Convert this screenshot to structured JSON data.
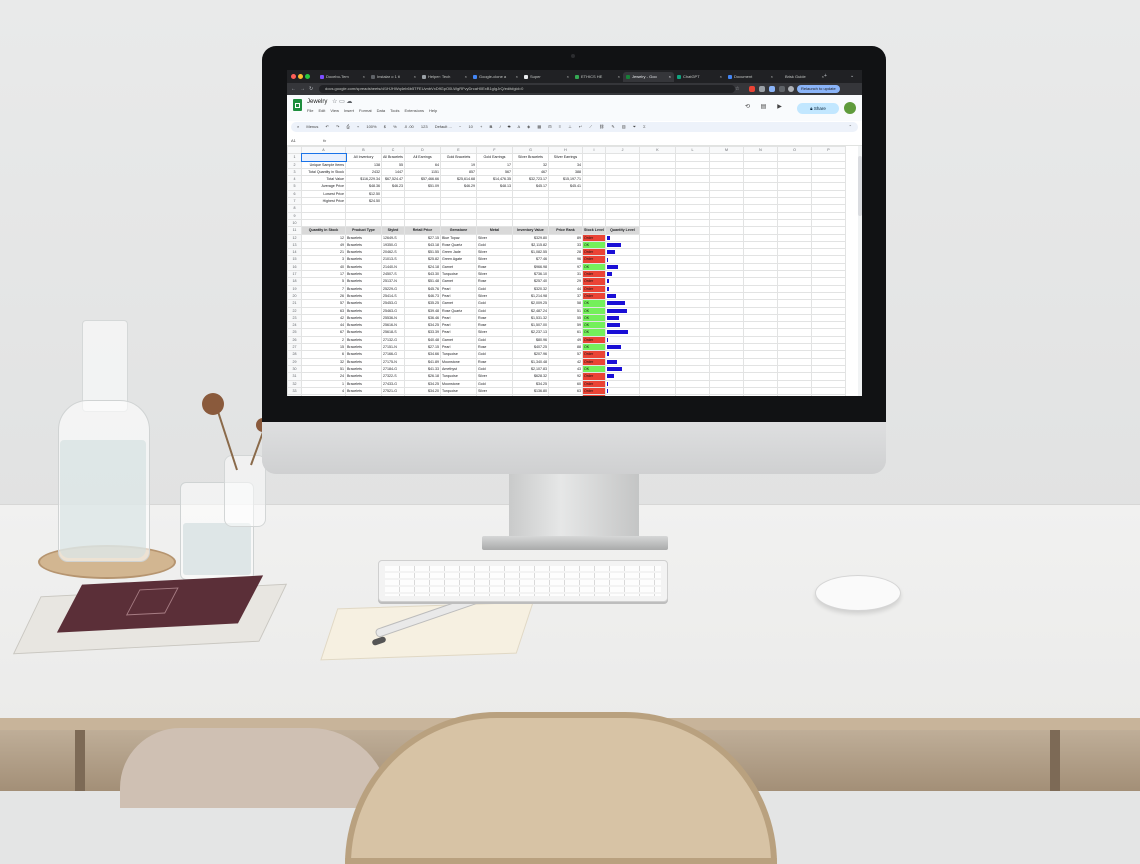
{
  "browser": {
    "tabs": [
      {
        "label": "Docebo-Tem",
        "icon_color": "#7c4dff"
      },
      {
        "label": "Instalar o 1 ti",
        "icon_color": "#5f6368"
      },
      {
        "label": "Helper: Tech",
        "icon_color": "#9aa0a6"
      },
      {
        "label": "Google-clone a",
        "icon_color": "#4285f4"
      },
      {
        "label": "Super",
        "icon_color": "#e8eaed"
      },
      {
        "label": "ETHICS HE",
        "icon_color": "#34a853"
      },
      {
        "label": "Jewelry - Goo",
        "icon_color": "#188038",
        "active": true
      },
      {
        "label": "ChatGPT",
        "icon_color": "#10a37f"
      },
      {
        "label": "Document",
        "icon_color": "#4285f4"
      },
      {
        "label": "Brisk Guide",
        "icon_color": "#202124"
      }
    ],
    "url": "docs.google.com/spreadsheets/d/1HJHWq4eb6b5TFEUvnbVxDflGpO0LWgRFvyDrcaH0ExB1gIgJrQ/edit#gid=0",
    "relaunch_label": "Relaunch to update",
    "new_tab_glyph": "+"
  },
  "sheets_app": {
    "doc_title": "Jewelry",
    "menus": [
      "File",
      "Edit",
      "View",
      "Insert",
      "Format",
      "Data",
      "Tools",
      "Extensions",
      "Help"
    ],
    "share_label": "Share",
    "toolbar": {
      "search_label": "Menus",
      "zoom": "100%",
      "currency": "$",
      "percent": "%",
      "decimals": ".0 .00",
      "number_format": "123",
      "font": "Default ...",
      "font_size": "10"
    },
    "formula_bar": {
      "cell_ref": "A1",
      "fx": "fx",
      "value": ""
    }
  },
  "sheet": {
    "column_letters": [
      "A",
      "B",
      "C",
      "D",
      "E",
      "F",
      "G",
      "H",
      "I",
      "J",
      "K",
      "L",
      "M",
      "N",
      "O",
      "P"
    ],
    "summary_headers": [
      "",
      "All Inventory",
      "All Bracelets",
      "All Earrings",
      "Gold Bracelets",
      "Gold Earrings",
      "Silver Bracelets",
      "Silver Earrings"
    ],
    "summary_rows": [
      {
        "label": "Unique Sample Items",
        "values": [
          "138",
          "55",
          "64",
          "19",
          "17",
          "32",
          "34"
        ]
      },
      {
        "label": "Total Quantity in Stock",
        "values": [
          "2432",
          "1447",
          "1151",
          "857",
          "567",
          "467",
          "388"
        ]
      },
      {
        "label": "Total Value",
        "values": [
          "$116,229.34",
          "$67,524.47",
          "$57,466.66",
          "$25,614.68",
          "$14,476.35",
          "$32,723.17",
          "$15,197.71"
        ]
      },
      {
        "label": "Average Price",
        "values": [
          "$48.36",
          "$46.23",
          "$51.09",
          "$46.29",
          "$48.13",
          "$45.17",
          "$45.41"
        ]
      },
      {
        "label": "Lowest Price",
        "values": [
          "$12.50",
          "",
          "",
          "",
          "",
          "",
          ""
        ]
      },
      {
        "label": "Highest Price",
        "values": [
          "$24.50",
          "",
          "",
          "",
          "",
          "",
          ""
        ]
      }
    ],
    "item_headers": [
      "Quantity in Stock",
      "Product Type",
      "Styled",
      "Retail Price",
      "Gemstone",
      "Metal",
      "Inventory Value",
      "Price Rank",
      "Stock Level",
      "Quantity Level"
    ],
    "items": [
      {
        "qty": "12",
        "type": "Bracelets",
        "sku": "12649-S",
        "price": "$27.15",
        "gem": "Blue Topaz",
        "metal": "Silver",
        "value": "$329.80",
        "rank": "89",
        "stock": "Order",
        "level": 0.14
      },
      {
        "qty": "49",
        "type": "Bracelets",
        "sku": "19350-G",
        "price": "$43.18",
        "gem": "Rose Quartz",
        "metal": "Gold",
        "value": "$2,115.82",
        "rank": "33",
        "stock": "OK",
        "level": 0.62
      },
      {
        "qty": "21",
        "type": "Bracelets",
        "sku": "20462-S",
        "price": "$51.55",
        "gem": "Green Jade",
        "metal": "Silver",
        "value": "$1,082.55",
        "rank": "28",
        "stock": "Order",
        "level": 0.36
      },
      {
        "qty": "3",
        "type": "Bracelets",
        "sku": "21013-S",
        "price": "$25.82",
        "gem": "Green Agate",
        "metal": "Silver",
        "value": "$77.46",
        "rank": "96",
        "stock": "Order",
        "level": 0.06
      },
      {
        "qty": "40",
        "type": "Bracelets",
        "sku": "21440-N",
        "price": "$24.18",
        "gem": "Garnet",
        "metal": "Rose",
        "value": "$966.98",
        "rank": "97",
        "stock": "OK",
        "level": 0.52
      },
      {
        "qty": "17",
        "type": "Bracelets",
        "sku": "24507-S",
        "price": "$43.30",
        "gem": "Turquoise",
        "metal": "Silver",
        "value": "$736.10",
        "rank": "31",
        "stock": "Order",
        "level": 0.24
      },
      {
        "qty": "5",
        "type": "Bracelets",
        "sku": "25137-N",
        "price": "$51.48",
        "gem": "Garnet",
        "metal": "Rose",
        "value": "$257.40",
        "rank": "29",
        "stock": "Order",
        "level": 0.08
      },
      {
        "qty": "7",
        "type": "Bracelets",
        "sku": "25229-G",
        "price": "$45.76",
        "gem": "Pearl",
        "metal": "Gold",
        "value": "$320.32",
        "rank": "44",
        "stock": "Order",
        "level": 0.1
      },
      {
        "qty": "26",
        "type": "Bracelets",
        "sku": "25414-S",
        "price": "$46.73",
        "gem": "Pearl",
        "metal": "Silver",
        "value": "$1,214.98",
        "rank": "37",
        "stock": "Order",
        "level": 0.42
      },
      {
        "qty": "57",
        "type": "Bracelets",
        "sku": "25453-G",
        "price": "$35.25",
        "gem": "Garnet",
        "metal": "Gold",
        "value": "$2,009.25",
        "rank": "58",
        "stock": "OK",
        "level": 0.8
      },
      {
        "qty": "63",
        "type": "Bracelets",
        "sku": "25463-G",
        "price": "$39.48",
        "gem": "Rose Quartz",
        "metal": "Gold",
        "value": "$2,487.24",
        "rank": "51",
        "stock": "OK",
        "level": 0.9
      },
      {
        "qty": "42",
        "type": "Bracelets",
        "sku": "25536-N",
        "price": "$36.46",
        "gem": "Pearl",
        "metal": "Rose",
        "value": "$1,531.32",
        "rank": "55",
        "stock": "OK",
        "level": 0.56
      },
      {
        "qty": "44",
        "type": "Bracelets",
        "sku": "25616-N",
        "price": "$34.25",
        "gem": "Pearl",
        "metal": "Rose",
        "value": "$1,507.00",
        "rank": "59",
        "stock": "OK",
        "level": 0.58
      },
      {
        "qty": "67",
        "type": "Bracelets",
        "sku": "25618-S",
        "price": "$33.39",
        "gem": "Pearl",
        "metal": "Silver",
        "value": "$2,237.13",
        "rank": "61",
        "stock": "OK",
        "level": 0.96
      },
      {
        "qty": "2",
        "type": "Bracelets",
        "sku": "27132-G",
        "price": "$40.48",
        "gem": "Garnet",
        "metal": "Gold",
        "value": "$80.96",
        "rank": "49",
        "stock": "Order",
        "level": 0.04
      },
      {
        "qty": "15",
        "type": "Bracelets",
        "sku": "27151-N",
        "price": "$27.15",
        "gem": "Pearl",
        "metal": "Rose",
        "value": "$407.25",
        "rank": "88",
        "stock": "OK",
        "level": 0.64
      },
      {
        "qty": "6",
        "type": "Bracelets",
        "sku": "27166-G",
        "price": "$34.66",
        "gem": "Turquoise",
        "metal": "Gold",
        "value": "$207.96",
        "rank": "57",
        "stock": "Order",
        "level": 0.09
      },
      {
        "qty": "32",
        "type": "Bracelets",
        "sku": "27175-N",
        "price": "$41.89",
        "gem": "Moonstone",
        "metal": "Rose",
        "value": "$1,340.48",
        "rank": "42",
        "stock": "Order",
        "level": 0.44
      },
      {
        "qty": "51",
        "type": "Bracelets",
        "sku": "27184-G",
        "price": "$41.33",
        "gem": "Amethyst",
        "metal": "Gold",
        "value": "$2,107.83",
        "rank": "43",
        "stock": "OK",
        "level": 0.68
      },
      {
        "qty": "24",
        "type": "Bracelets",
        "sku": "27322-S",
        "price": "$26.18",
        "gem": "Turquoise",
        "metal": "Silver",
        "value": "$628.32",
        "rank": "92",
        "stock": "Order",
        "level": 0.34
      },
      {
        "qty": "1",
        "type": "Bracelets",
        "sku": "27433-G",
        "price": "$34.25",
        "gem": "Moonstone",
        "metal": "Gold",
        "value": "$34.25",
        "rank": "60",
        "stock": "Order",
        "level": 0.03
      },
      {
        "qty": "4",
        "type": "Bracelets",
        "sku": "27521-G",
        "price": "$34.20",
        "gem": "Turquoise",
        "metal": "Silver",
        "value": "$136.80",
        "rank": "63",
        "stock": "Order",
        "level": 0.06
      },
      {
        "qty": "4",
        "type": "Bracelets",
        "sku": "27543-N",
        "price": "$53.58",
        "gem": "Red Jasper",
        "metal": "Rose",
        "value": "$214.32",
        "rank": "24",
        "stock": "Order",
        "level": 0.06
      }
    ],
    "row_numbers_summary": [
      "1",
      "2",
      "3",
      "4",
      "5",
      "6",
      "7",
      "8",
      "9",
      "10",
      "11"
    ],
    "row_first_item": 12,
    "colors": {
      "order": "#ea4335",
      "ok": "#74f05b",
      "bar": "#1a0fd6",
      "select": "#1a73e8"
    }
  }
}
